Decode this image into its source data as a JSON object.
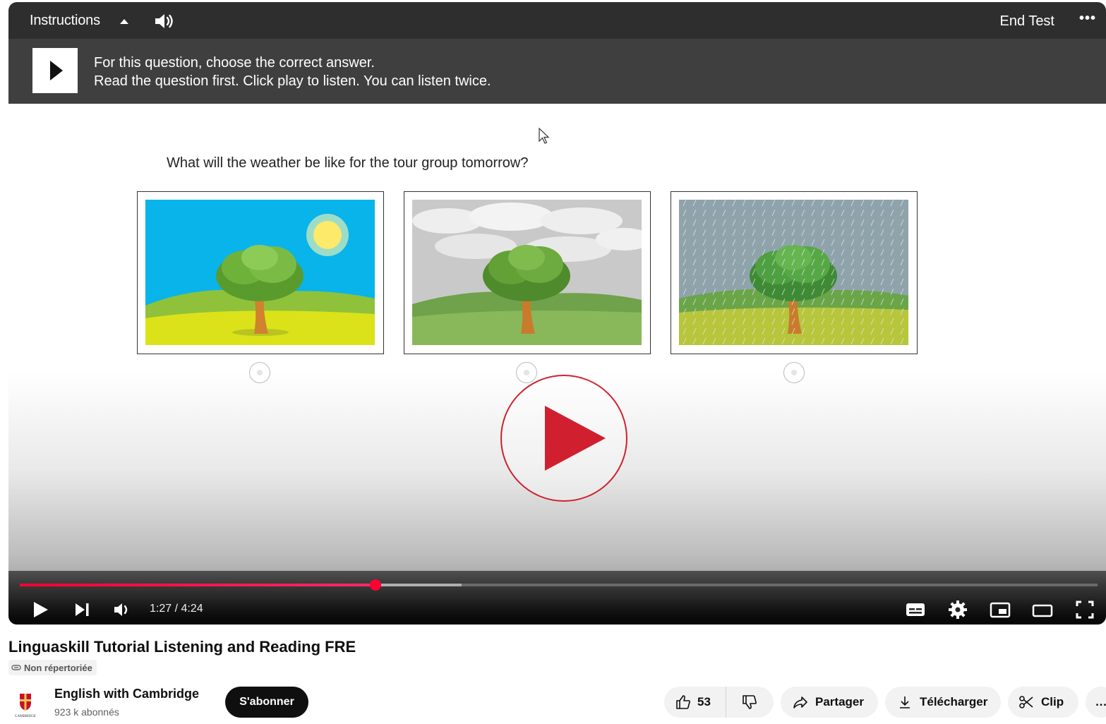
{
  "test_header": {
    "instructions_label": "Instructions",
    "end_test_label": "End Test",
    "more_label": "•••"
  },
  "instructions": {
    "line1": "For this question, choose the correct answer.",
    "line2": "Read the question first. Click play to listen. You can listen twice."
  },
  "question": {
    "text": "What will the weather be like for the tour group tomorrow?",
    "options": [
      {
        "depicts": "sunny"
      },
      {
        "depicts": "cloudy"
      },
      {
        "depicts": "rainy"
      }
    ]
  },
  "player": {
    "current_time": "1:27",
    "duration": "4:24",
    "time_display": "1:27 / 4:24",
    "progress_fraction": 0.33,
    "buffered_fraction": 0.41,
    "accent_color": "#ff0033",
    "play_button_color": "#d0202f"
  },
  "video": {
    "title": "Linguaskill Tutorial Listening and Reading FRE",
    "visibility": "Non répertoriée"
  },
  "channel": {
    "name": "English with Cambridge",
    "subscribers": "923 k abonnés",
    "subscribe_label": "S'abonner",
    "logo_caption": "CAMBRIDGE"
  },
  "actions": {
    "like_count": "53",
    "share_label": "Partager",
    "download_label": "Télécharger",
    "clip_label": "Clip",
    "more_label": "…"
  }
}
